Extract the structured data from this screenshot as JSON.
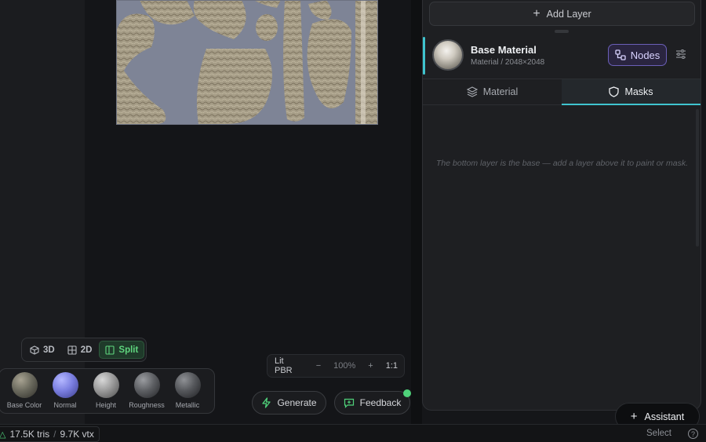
{
  "panel": {
    "add_layer_label": "Add Layer",
    "layer": {
      "name": "Base Material",
      "subtitle": "Material / 2048×2048",
      "nodes_label": "Nodes"
    },
    "tabs": [
      {
        "label": "Material",
        "icon": "layers-icon",
        "active": false
      },
      {
        "label": "Masks",
        "icon": "shield-icon",
        "active": true
      }
    ],
    "hint_text": "The bottom layer is the base — add a layer above it to paint or mask."
  },
  "view_toggle": {
    "options": [
      {
        "label": "3D",
        "icon": "cube-icon",
        "active": false
      },
      {
        "label": "2D",
        "icon": "grid-icon",
        "active": false
      },
      {
        "label": "Split",
        "icon": "split-icon",
        "active": true
      }
    ]
  },
  "maps": [
    {
      "label": "Base Color",
      "color": "#6b6a5e"
    },
    {
      "label": "Normal",
      "color": "#7b7fe0"
    },
    {
      "label": "Height",
      "color": "#9a9a9a"
    },
    {
      "label": "Roughness",
      "color": "#5d5f63"
    },
    {
      "label": "Metallic",
      "color": "#55575b"
    }
  ],
  "render_bar": {
    "shading": "Lit PBR",
    "zoom_out": "−",
    "zoom": "100%",
    "zoom_in": "+",
    "fit": "1:1"
  },
  "actions": {
    "generate_label": "Generate",
    "feedback_label": "Feedback",
    "assistant_label": "Assistant"
  },
  "status": {
    "tris": "17.5K tris",
    "separator": "/",
    "vtx": "9.7K vtx",
    "mode": "Select",
    "help": "?"
  },
  "colors": {
    "accent": "#3fc4cf",
    "split_active": "#5fd57e",
    "nodes_accent": "#6b5fb8",
    "notify": "#4fd27a"
  }
}
